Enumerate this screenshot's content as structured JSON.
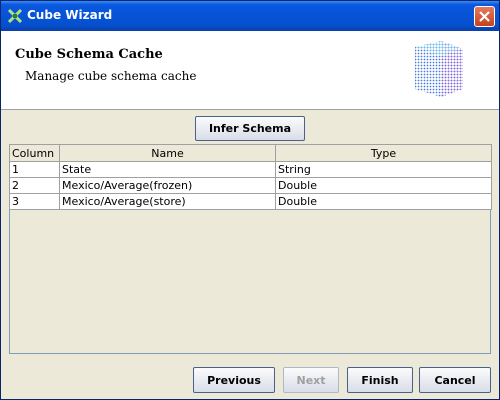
{
  "window": {
    "title": "Cube Wizard"
  },
  "header": {
    "title": "Cube Schema Cache",
    "subtitle": "Manage cube schema cache"
  },
  "infer_button": {
    "label": "Infer Schema"
  },
  "table": {
    "columns": [
      "Column",
      "Name",
      "Type"
    ],
    "rows": [
      [
        "1",
        "State",
        "String"
      ],
      [
        "2",
        "Mexico/Average(frozen)",
        "Double"
      ],
      [
        "3",
        "Mexico/Average(store)",
        "Double"
      ]
    ]
  },
  "footer": {
    "previous_label": "Previous",
    "next_label": "Next",
    "finish_label": "Finish",
    "cancel_label": "Cancel"
  }
}
